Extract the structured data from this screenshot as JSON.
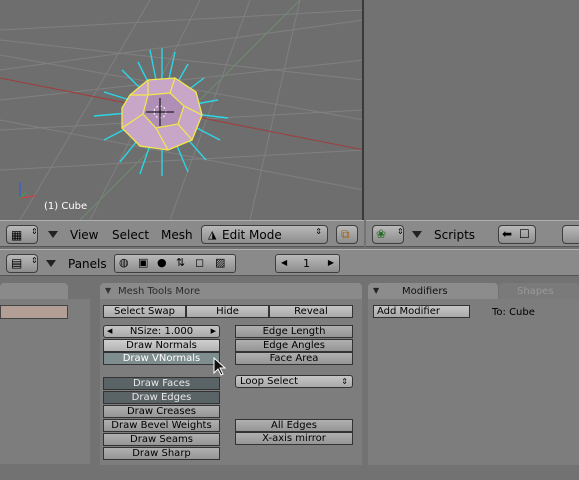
{
  "viewport": {
    "object_label": "(1) Cube"
  },
  "view3d_header": {
    "menus": [
      "View",
      "Select",
      "Mesh"
    ],
    "mode": "Edit Mode"
  },
  "scripts_header": {
    "menu": "Scripts"
  },
  "buttons_header": {
    "panels_label": "Panels",
    "frame": "1"
  },
  "mesh_tools_panel": {
    "title": "Mesh Tools More",
    "select_swap": "Select Swap",
    "hide": "Hide",
    "reveal": "Reveal",
    "nsize": "NSize: 1.000",
    "draw_normals": "Draw Normals",
    "draw_vnormals": "Draw VNormals",
    "edge_length": "Edge Length",
    "edge_angles": "Edge Angles",
    "face_area": "Face Area",
    "draw_faces": "Draw Faces",
    "draw_edges": "Draw Edges",
    "draw_creases": "Draw Creases",
    "draw_bevel_weights": "Draw Bevel Weights",
    "draw_seams": "Draw Seams",
    "draw_sharp": "Draw Sharp",
    "loop_select": "Loop Select",
    "all_edges": "All Edges",
    "x_axis_mirror": "X-axis mirror"
  },
  "modifiers_panel": {
    "tab_modifiers": "Modifiers",
    "tab_shapes": "Shapes",
    "add_modifier": "Add Modifier",
    "to_label": "To: Cube"
  },
  "colors": {
    "selected_vertex": "#f5e84a",
    "normal": "#2bd6e6",
    "face": "#c8a6c8"
  }
}
